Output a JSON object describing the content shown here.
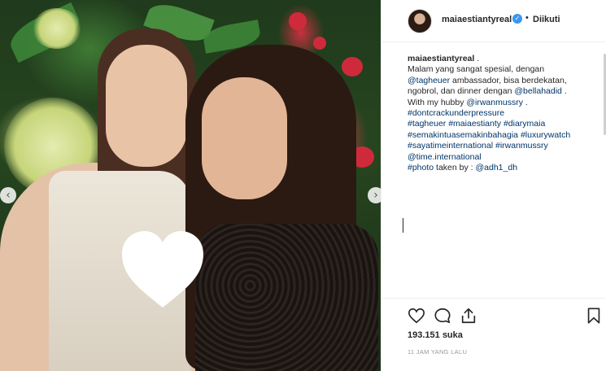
{
  "post": {
    "username": "maiaestiantyreal",
    "separator": "•",
    "follow_status": "Diikuti",
    "caption_username": "maiaestiantyreal",
    "caption_username_suffix": " .",
    "caption_lines": [
      [
        {
          "t": "Malam yang sangat spesial, dengan"
        }
      ],
      [
        {
          "t": "@tagheuer",
          "tag": true
        },
        {
          "t": " ambassador, bisa berdekatan,"
        }
      ],
      [
        {
          "t": "ngobrol, dan dinner dengan "
        },
        {
          "t": "@bellahadid",
          "tag": true
        },
        {
          "t": " ."
        }
      ],
      [
        {
          "t": "With my hubby "
        },
        {
          "t": "@irwanmussry",
          "tag": true
        },
        {
          "t": " ."
        }
      ],
      [
        {
          "t": "#dontcrackunderpressure",
          "tag": true
        }
      ],
      [
        {
          "t": "#tagheuer",
          "tag": true
        },
        {
          "t": " "
        },
        {
          "t": "#maiaestianty",
          "tag": true
        },
        {
          "t": " "
        },
        {
          "t": "#diarymaia",
          "tag": true
        }
      ],
      [
        {
          "t": "#semakintuasemakinbahagia",
          "tag": true
        },
        {
          "t": " "
        },
        {
          "t": "#luxurywatch",
          "tag": true
        }
      ],
      [
        {
          "t": "#sayatimeinternational",
          "tag": true
        },
        {
          "t": " "
        },
        {
          "t": "#irwanmussry",
          "tag": true
        }
      ],
      [
        {
          "t": "@time.international",
          "tag": true
        }
      ],
      [
        {
          "t": "#photo",
          "tag": true
        },
        {
          "t": " taken by : "
        },
        {
          "t": "@adh1_dh",
          "tag": true
        }
      ]
    ],
    "likes": "193.151 suka",
    "timestamp": "11 JAM YANG LALU"
  },
  "photo": {
    "prev_arrow": "‹",
    "next_arrow": "›"
  },
  "icons": {
    "like": "heart-outline-icon",
    "comment": "comment-bubble-icon",
    "share": "share-upload-icon",
    "save": "bookmark-icon"
  },
  "colors": {
    "link": "#003569",
    "verified": "#3897f0",
    "text": "#262626",
    "muted": "#999999"
  }
}
